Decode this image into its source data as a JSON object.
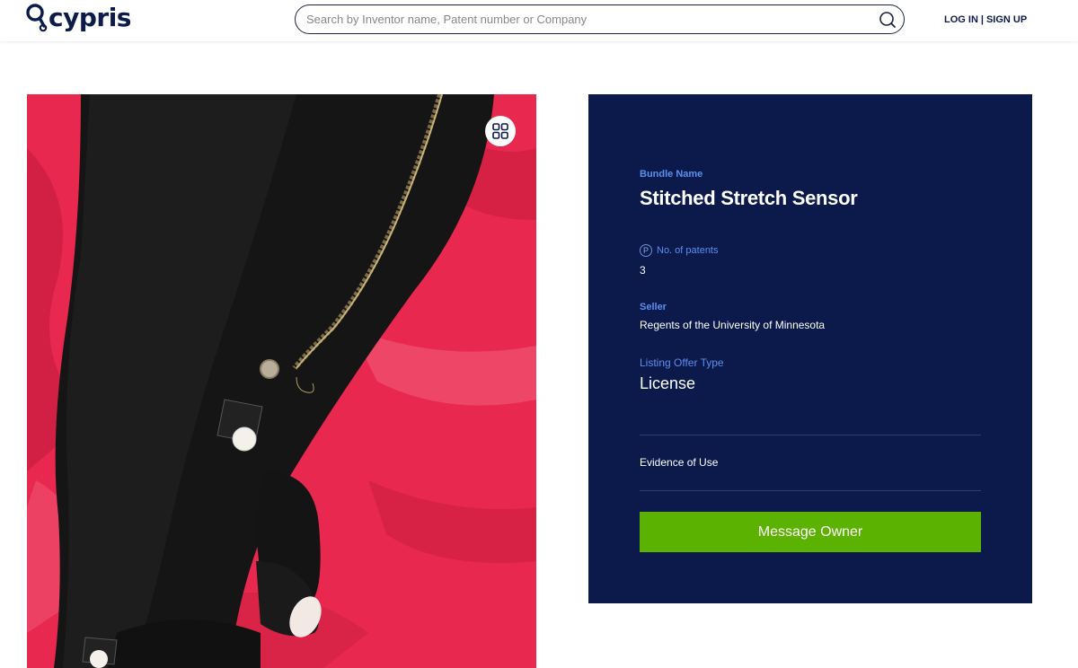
{
  "header": {
    "logo_text": "cypris",
    "search_placeholder": "Search by Inventor name, Patent number or Company",
    "login_label": "LOG IN",
    "separator": "|",
    "signup_label": "SIGN UP"
  },
  "listing": {
    "bundle_label": "Bundle Name",
    "bundle_name": "Stitched Stretch Sensor",
    "patents_icon": "P",
    "patents_label": "No. of patents",
    "patents_count": "3",
    "seller_label": "Seller",
    "seller_name": "Regents of the University of Minnesota",
    "offer_type_label": "Listing Offer Type",
    "offer_type": "License",
    "evidence_label": "Evidence of Use",
    "message_button": "Message Owner"
  },
  "colors": {
    "brand_navy": "#0d1b4b",
    "card_bg": "#0b1a4a",
    "label_blue": "#5d8ef0",
    "button_green": "#5cb200"
  },
  "icons": {
    "search": "search-icon",
    "gallery": "grid-icon",
    "logo": "key-logo-icon"
  }
}
